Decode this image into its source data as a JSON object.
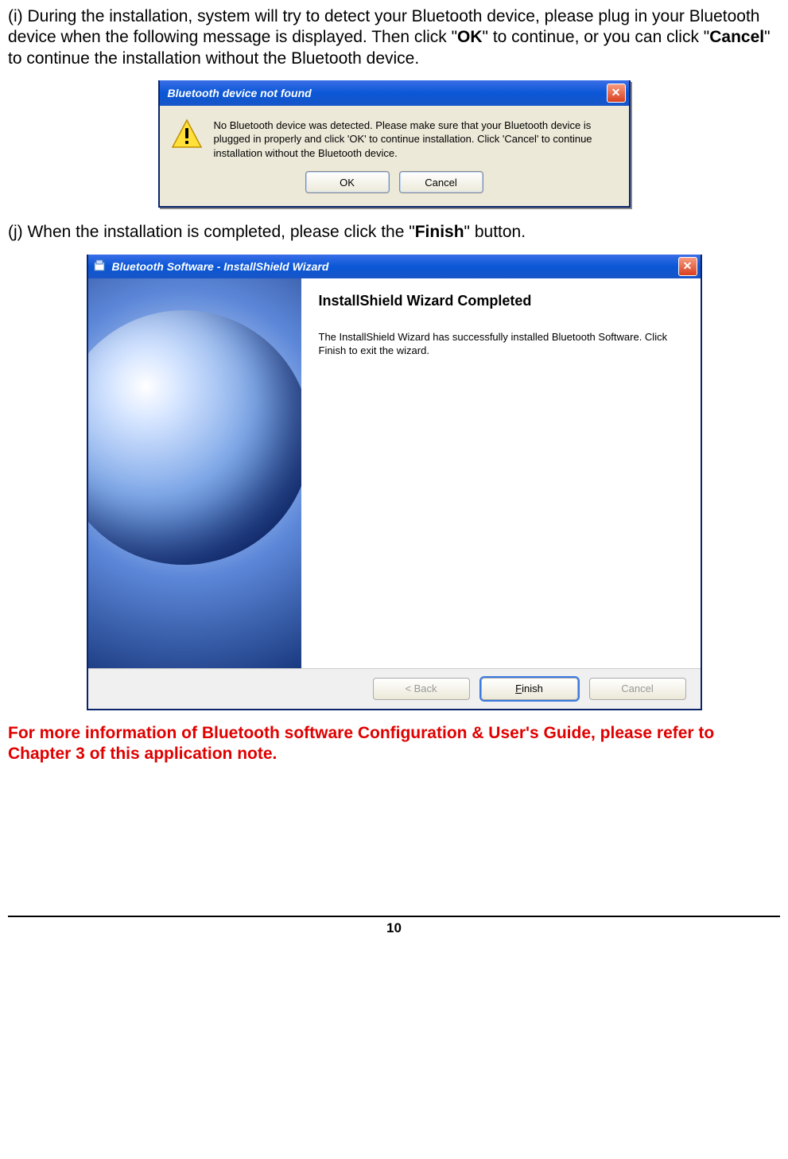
{
  "para_i": {
    "prefix": "(i) During the installation, system will try to detect your Bluetooth device, please plug in your Bluetooth device when the following message is displayed. Then click \"",
    "ok": "OK",
    "mid": "\" to continue, or you can click \"",
    "cancel": "Cancel",
    "suffix": "\" to continue the installation without the Bluetooth device."
  },
  "dialog1": {
    "title": "Bluetooth device not found",
    "message": "No Bluetooth device was detected. Please make sure that your Bluetooth device is plugged in properly and click 'OK' to continue installation. Click 'Cancel' to continue installation without the Bluetooth device.",
    "ok": "OK",
    "cancel": "Cancel"
  },
  "para_j": {
    "prefix": "(j) When the installation is completed, please click the \"",
    "finish": "Finish",
    "suffix": "\" button."
  },
  "dialog2": {
    "title": "Bluetooth Software - InstallShield Wizard",
    "heading": "InstallShield Wizard Completed",
    "body": "The InstallShield Wizard has successfully installed Bluetooth Software. Click Finish to exit the wizard.",
    "back": "< Back",
    "finish_u": "F",
    "finish_rest": "inish",
    "cancel": "Cancel"
  },
  "red_note": "For more information of Bluetooth software Configuration & User's Guide, please refer to Chapter 3 of this application note.",
  "page_number": "10"
}
